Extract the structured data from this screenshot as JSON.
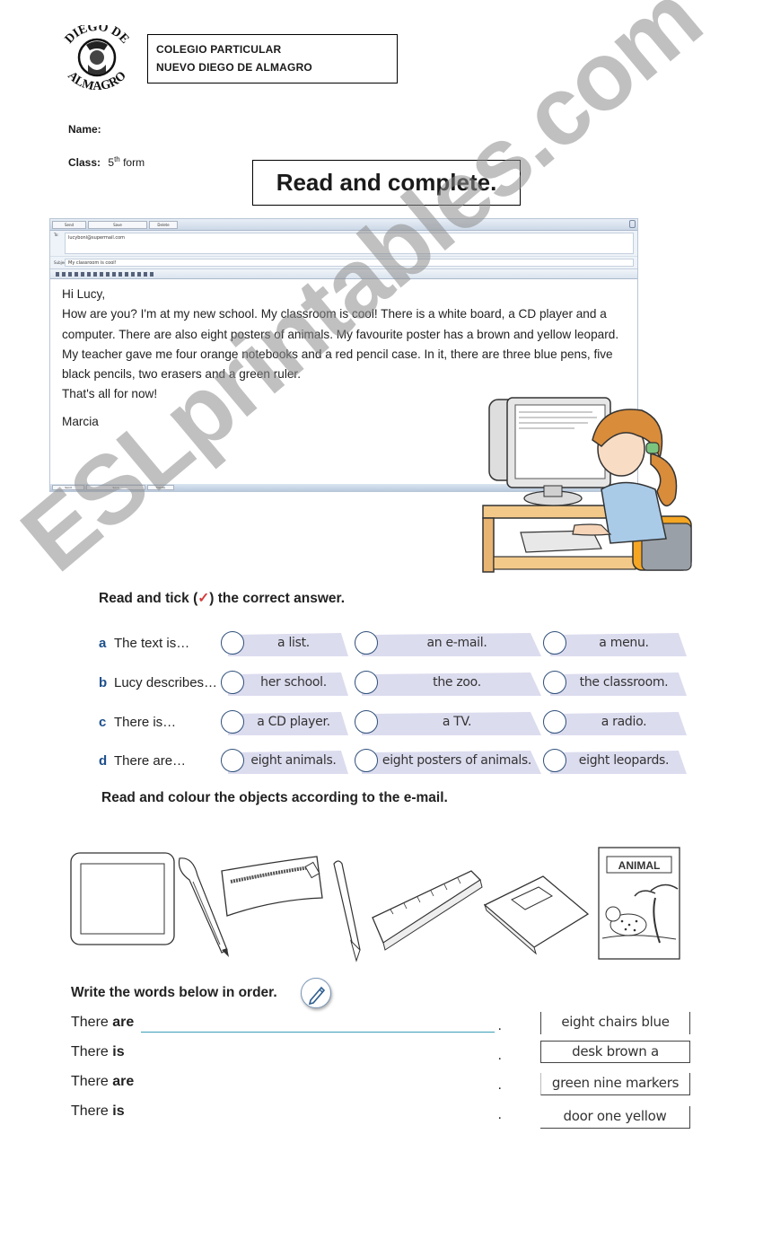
{
  "header": {
    "logo_alt": "Diego de Almagro crest",
    "logo_text_top": "DIEGO DE",
    "logo_text_bottom": "ALMAGRO",
    "school_line1": "COLEGIO PARTICULAR",
    "school_line2": "NUEVO DIEGO DE ALMAGRO",
    "name_label": "Name:",
    "class_label": "Class:",
    "class_value_num": "5",
    "class_value_sup": "th",
    "class_value_rest": "form"
  },
  "title": "Read and complete.",
  "email": {
    "toolbar_buttons": [
      "Send",
      "Save",
      "Delete"
    ],
    "to_label": "To:",
    "to_value": "lucyboni@supermail.com",
    "subject_label": "Subject:",
    "subject_value": "My classroom is cool!",
    "greeting": "Hi Lucy,",
    "paragraph1": "How are you? I'm at my new school. My classroom is cool! There is a white board, a CD player and a computer. There are also eight posters of animals. My favourite poster has a brown and yellow leopard.",
    "paragraph2": "My teacher gave me four orange notebooks and a red pencil case. In it, there are three blue pens, five black pencils, two erasers and a green ruler.",
    "closing": "That's all for now!",
    "signature": "Marcia"
  },
  "watermark": "ESLprintables.com",
  "tick_section": {
    "heading_before": "Read and tick (",
    "check_mark": "✓",
    "heading_after": ") the correct answer.",
    "check_color": "#d23a3a",
    "questions": [
      {
        "letter": "a",
        "stem": "The text is…",
        "options": [
          "a list.",
          "an e-mail.",
          "a menu."
        ]
      },
      {
        "letter": "b",
        "stem": "Lucy describes…",
        "options": [
          "her school.",
          "the zoo.",
          "the classroom."
        ]
      },
      {
        "letter": "c",
        "stem": "There is…",
        "options": [
          "a CD player.",
          "a TV.",
          "a radio."
        ]
      },
      {
        "letter": "d",
        "stem": "There are…",
        "options": [
          "eight animals.",
          "eight posters of animals.",
          "eight leopards."
        ]
      }
    ]
  },
  "colour_section": {
    "heading": "Read and colour the objects according to the e-mail.",
    "objects": [
      "white board",
      "pen",
      "pencil case",
      "pencil",
      "ruler",
      "notebook",
      "animal poster"
    ],
    "poster_text": "ANIMAL"
  },
  "write_section": {
    "heading": "Write the words below in order.",
    "rows": [
      {
        "prefix": "There",
        "verb": "are",
        "end": "."
      },
      {
        "prefix": "There",
        "verb": "is",
        "end": "."
      },
      {
        "prefix": "There",
        "verb": "are",
        "end": "."
      },
      {
        "prefix": "There",
        "verb": "is",
        "end": "."
      }
    ],
    "word_boxes": [
      "eight chairs blue",
      "desk brown a",
      "green nine markers",
      "door one yellow"
    ]
  }
}
